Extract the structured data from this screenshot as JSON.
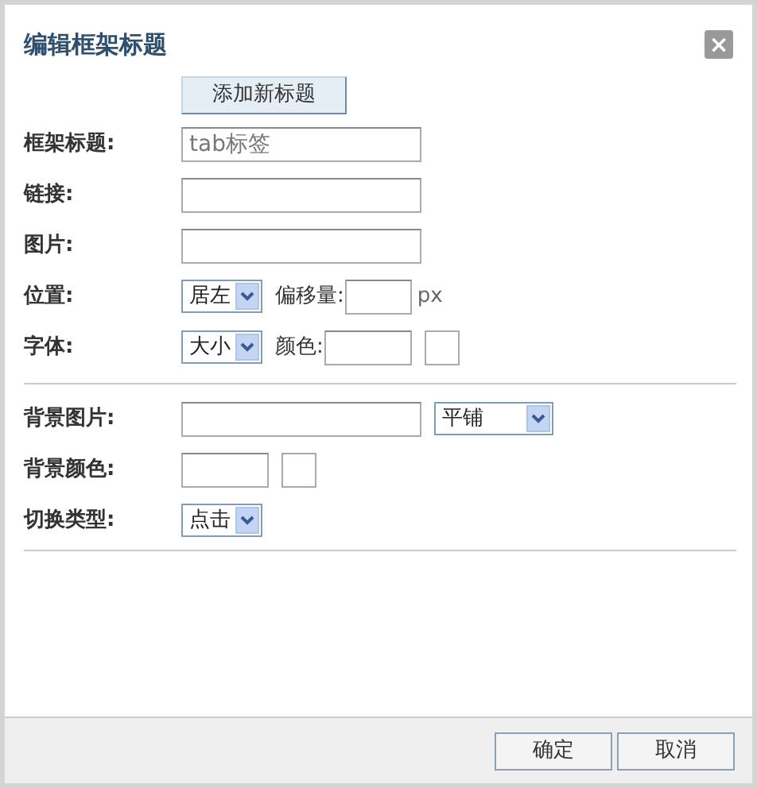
{
  "dialog": {
    "title": "编辑框架标题",
    "close": "×"
  },
  "add_button": "添加新标题",
  "section_1": [
    {
      "label": "框架标题:",
      "controls": [
        {
          "kind": "wide_input",
          "placeholder": "tab标签"
        }
      ]
    },
    {
      "label": "链接:",
      "controls": [
        {
          "kind": "wide_input"
        }
      ]
    },
    {
      "label": "图片:",
      "controls": [
        {
          "kind": "wide_input"
        }
      ]
    },
    {
      "label": "位置:",
      "controls": [
        {
          "kind": "select",
          "value": "居左"
        },
        {
          "kind": "small_input",
          "label": "偏移量:",
          "suffix": "px"
        }
      ]
    },
    {
      "label": "字体:",
      "controls": [
        {
          "kind": "select",
          "value": "大小"
        },
        {
          "kind": "medium_input",
          "label": "颜色:"
        },
        {
          "kind": "swatch"
        }
      ]
    }
  ],
  "section_2": [
    {
      "label": "背景图片:",
      "controls": [
        {
          "kind": "wide_input"
        },
        {
          "kind": "wide_select",
          "value": "平铺"
        }
      ]
    },
    {
      "label": "背景颜色:",
      "controls": [
        {
          "kind": "medium_input"
        },
        {
          "kind": "swatch"
        }
      ]
    },
    {
      "label": "切换类型:",
      "controls": [
        {
          "kind": "select",
          "value": "点击"
        }
      ]
    }
  ],
  "footer_buttons": [
    "确定",
    "取消"
  ]
}
